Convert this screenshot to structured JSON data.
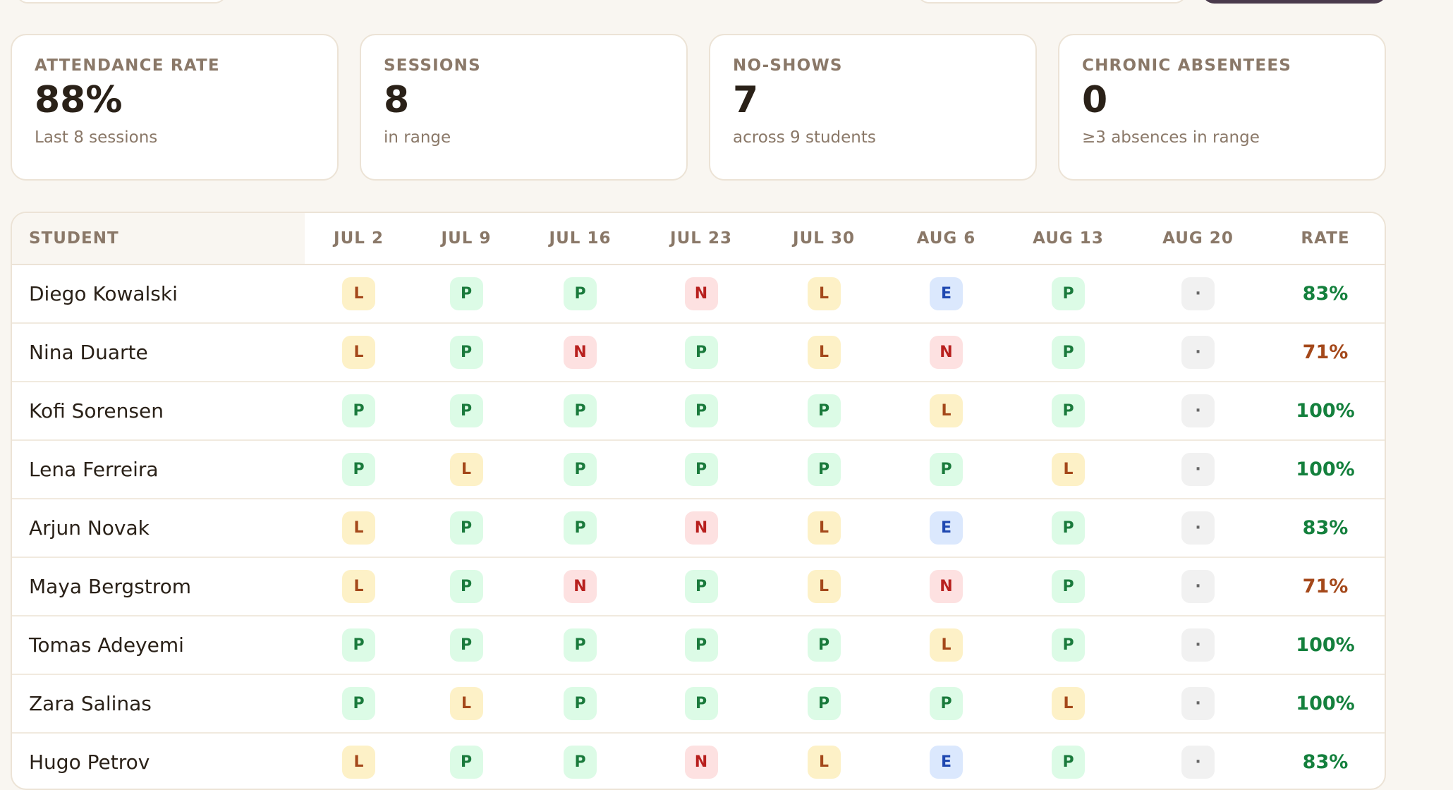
{
  "stats": [
    {
      "label": "ATTENDANCE RATE",
      "value": "88%",
      "sub": "Last 8 sessions"
    },
    {
      "label": "SESSIONS",
      "value": "8",
      "sub": "in range"
    },
    {
      "label": "NO-SHOWS",
      "value": "7",
      "sub": "across 9 students"
    },
    {
      "label": "CHRONIC ABSENTEES",
      "value": "0",
      "sub": "≥3 absences in range"
    }
  ],
  "table": {
    "student_header": "STUDENT",
    "date_headers": [
      "JUL 2",
      "JUL 9",
      "JUL 16",
      "JUL 23",
      "JUL 30",
      "AUG 6",
      "AUG 13",
      "AUG 20"
    ],
    "rate_header": "RATE",
    "rows": [
      {
        "name": "Diego Kowalski",
        "marks": [
          "L",
          "P",
          "P",
          "N",
          "L",
          "E",
          "P",
          "·"
        ],
        "rate": "83%",
        "rate_status": "good"
      },
      {
        "name": "Nina Duarte",
        "marks": [
          "L",
          "P",
          "N",
          "P",
          "L",
          "N",
          "P",
          "·"
        ],
        "rate": "71%",
        "rate_status": "warn"
      },
      {
        "name": "Kofi Sorensen",
        "marks": [
          "P",
          "P",
          "P",
          "P",
          "P",
          "L",
          "P",
          "·"
        ],
        "rate": "100%",
        "rate_status": "good"
      },
      {
        "name": "Lena Ferreira",
        "marks": [
          "P",
          "L",
          "P",
          "P",
          "P",
          "P",
          "L",
          "·"
        ],
        "rate": "100%",
        "rate_status": "good"
      },
      {
        "name": "Arjun Novak",
        "marks": [
          "L",
          "P",
          "P",
          "N",
          "L",
          "E",
          "P",
          "·"
        ],
        "rate": "83%",
        "rate_status": "good"
      },
      {
        "name": "Maya Bergstrom",
        "marks": [
          "L",
          "P",
          "N",
          "P",
          "L",
          "N",
          "P",
          "·"
        ],
        "rate": "71%",
        "rate_status": "warn"
      },
      {
        "name": "Tomas Adeyemi",
        "marks": [
          "P",
          "P",
          "P",
          "P",
          "P",
          "L",
          "P",
          "·"
        ],
        "rate": "100%",
        "rate_status": "good"
      },
      {
        "name": "Zara Salinas",
        "marks": [
          "P",
          "L",
          "P",
          "P",
          "P",
          "P",
          "L",
          "·"
        ],
        "rate": "100%",
        "rate_status": "good"
      },
      {
        "name": "Hugo Petrov",
        "marks": [
          "L",
          "P",
          "P",
          "N",
          "L",
          "E",
          "P",
          "·"
        ],
        "rate": "83%",
        "rate_status": "good"
      }
    ]
  },
  "colors": {
    "present_bg": "#dcfbe6",
    "present_fg": "#1a7a3c",
    "late_bg": "#fdf1c7",
    "late_fg": "#a4481a",
    "noshow_bg": "#fde1e1",
    "noshow_fg": "#b8201e",
    "excused_bg": "#dbe8fd",
    "excused_fg": "#1e47b0",
    "rate_good": "#14803d",
    "rate_warn": "#a4481a",
    "primary_button": "#4a3a4c"
  }
}
